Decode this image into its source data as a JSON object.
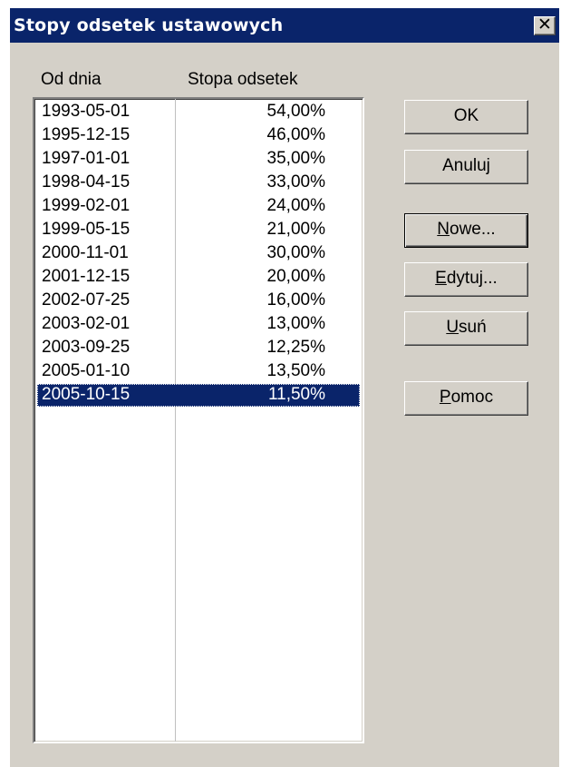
{
  "dialog": {
    "title": "Stopy odsetek ustawowych",
    "close_glyph": "✕"
  },
  "list": {
    "columns": [
      "Od dnia",
      "Stopa odsetek"
    ],
    "rows": [
      {
        "date": "1993-05-01",
        "rate": "54,00%"
      },
      {
        "date": "1995-12-15",
        "rate": "46,00%"
      },
      {
        "date": "1997-01-01",
        "rate": "35,00%"
      },
      {
        "date": "1998-04-15",
        "rate": "33,00%"
      },
      {
        "date": "1999-02-01",
        "rate": "24,00%"
      },
      {
        "date": "1999-05-15",
        "rate": "21,00%"
      },
      {
        "date": "2000-11-01",
        "rate": "30,00%"
      },
      {
        "date": "2001-12-15",
        "rate": "20,00%"
      },
      {
        "date": "2002-07-25",
        "rate": "16,00%"
      },
      {
        "date": "2003-02-01",
        "rate": "13,00%"
      },
      {
        "date": "2003-09-25",
        "rate": "12,25%"
      },
      {
        "date": "2005-01-10",
        "rate": "13,50%"
      },
      {
        "date": "2005-10-15",
        "rate": "11,50%"
      }
    ],
    "selected_index": 12
  },
  "buttons": {
    "ok": {
      "label": "OK"
    },
    "cancel": {
      "label": "Anuluj"
    },
    "new": {
      "accel": "N",
      "rest": "owe..."
    },
    "edit": {
      "accel": "E",
      "rest": "dytuj..."
    },
    "delete": {
      "accel": "U",
      "rest": "suń"
    },
    "help": {
      "accel": "P",
      "rest": "omoc"
    }
  },
  "colors": {
    "dialog_bg": "#d4d0c8",
    "titlebar_bg": "#0a246a",
    "selection_bg": "#0a246a"
  }
}
